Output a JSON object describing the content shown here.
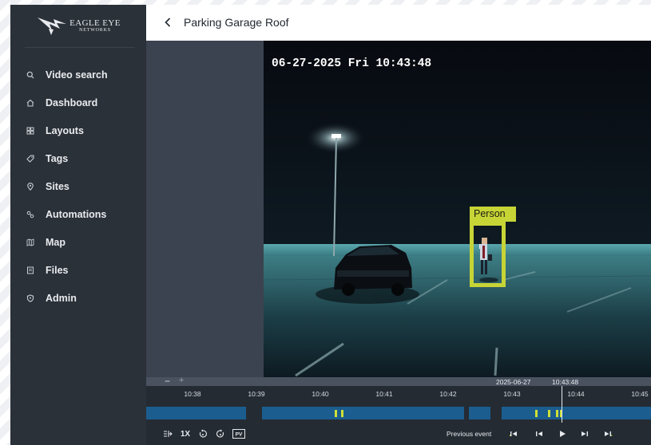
{
  "brand": {
    "name": "EAGLE EYE",
    "sub": "NETWORKS"
  },
  "sidebar": {
    "items": [
      {
        "label": "Video search",
        "icon": "search-icon"
      },
      {
        "label": "Dashboard",
        "icon": "home-icon"
      },
      {
        "label": "Layouts",
        "icon": "layouts-icon"
      },
      {
        "label": "Tags",
        "icon": "tag-icon"
      },
      {
        "label": "Sites",
        "icon": "location-pin-icon"
      },
      {
        "label": "Automations",
        "icon": "automations-icon"
      },
      {
        "label": "Map",
        "icon": "map-icon"
      },
      {
        "label": "Files",
        "icon": "files-icon"
      },
      {
        "label": "Admin",
        "icon": "shield-icon"
      }
    ]
  },
  "header": {
    "title": "Parking Garage Roof"
  },
  "video": {
    "timestamp": "06-27-2025 Fri 10:43:48",
    "detection_label": "Person"
  },
  "timeline": {
    "zoom_out": "−",
    "zoom_in": "+",
    "current_date": "2025-06-27",
    "current_time": "10:43:48",
    "ticks": [
      "10:38",
      "10:39",
      "10:40",
      "10:41",
      "10:42",
      "10:43",
      "10:44",
      "10:45"
    ],
    "speed": "1X",
    "pv_label": "PV",
    "previous_event_label": "Previous event"
  },
  "colors": {
    "sidebar_bg": "#2b3139",
    "detection": "#c7d436",
    "recording_segment": "#1b5d8f",
    "event_marker": "#cfe037"
  }
}
